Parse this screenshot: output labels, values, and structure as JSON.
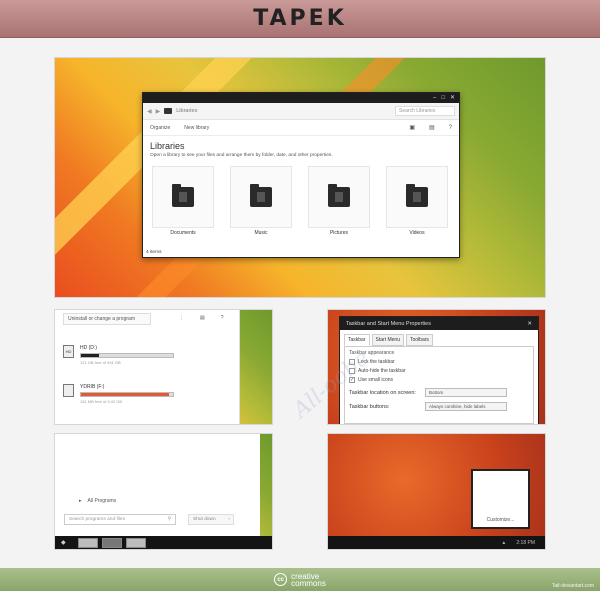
{
  "header": {
    "title": "TAPEK"
  },
  "explorer": {
    "address": "Libraries",
    "search_placeholder": "Search Libraries",
    "organize": "Organize",
    "new_library": "New library",
    "title": "Libraries",
    "subtitle": "Open a library to see your files and arrange them by folder, date, and other properties.",
    "libraries": [
      {
        "label": "Documents"
      },
      {
        "label": "Music"
      },
      {
        "label": "Pictures"
      },
      {
        "label": "Videos"
      }
    ],
    "status": "4 items"
  },
  "uninstall": {
    "tab": "Uninstall or change a program",
    "drives": [
      {
        "name": "HD (D:)",
        "icon": "HD",
        "meta": "121 GB free of 931 GB",
        "fill": 0.2,
        "color": "#222222"
      },
      {
        "name": "YDRIB (F:)",
        "icon": "",
        "meta": "131 MB free of 3.42 GB",
        "fill": 0.96,
        "color": "#e05a3a"
      }
    ]
  },
  "taskbar_props": {
    "title": "Taskbar and Start Menu Properties",
    "tabs": [
      "Taskbar",
      "Start Menu",
      "Toolbars"
    ],
    "group": "Taskbar appearance",
    "checks": [
      {
        "label": "Lock the taskbar",
        "checked": false
      },
      {
        "label": "Auto-hide the taskbar",
        "checked": false
      },
      {
        "label": "Use small icons",
        "checked": true
      }
    ],
    "location_label": "Taskbar location on screen:",
    "location_value": "Bottom",
    "buttons_label": "Taskbar buttons:",
    "buttons_value": "Always combine, hide labels"
  },
  "start_menu": {
    "all_programs": "All Programs",
    "search_placeholder": "Search programs and files",
    "shutdown": "Shut down"
  },
  "desktop": {
    "customize": "Customize...",
    "clock": "2:18 PM"
  },
  "footer": {
    "cc_line1": "creative",
    "cc_line2": "commons",
    "credit": "Tatl-deviantart.com"
  },
  "watermark": "All-oobe"
}
